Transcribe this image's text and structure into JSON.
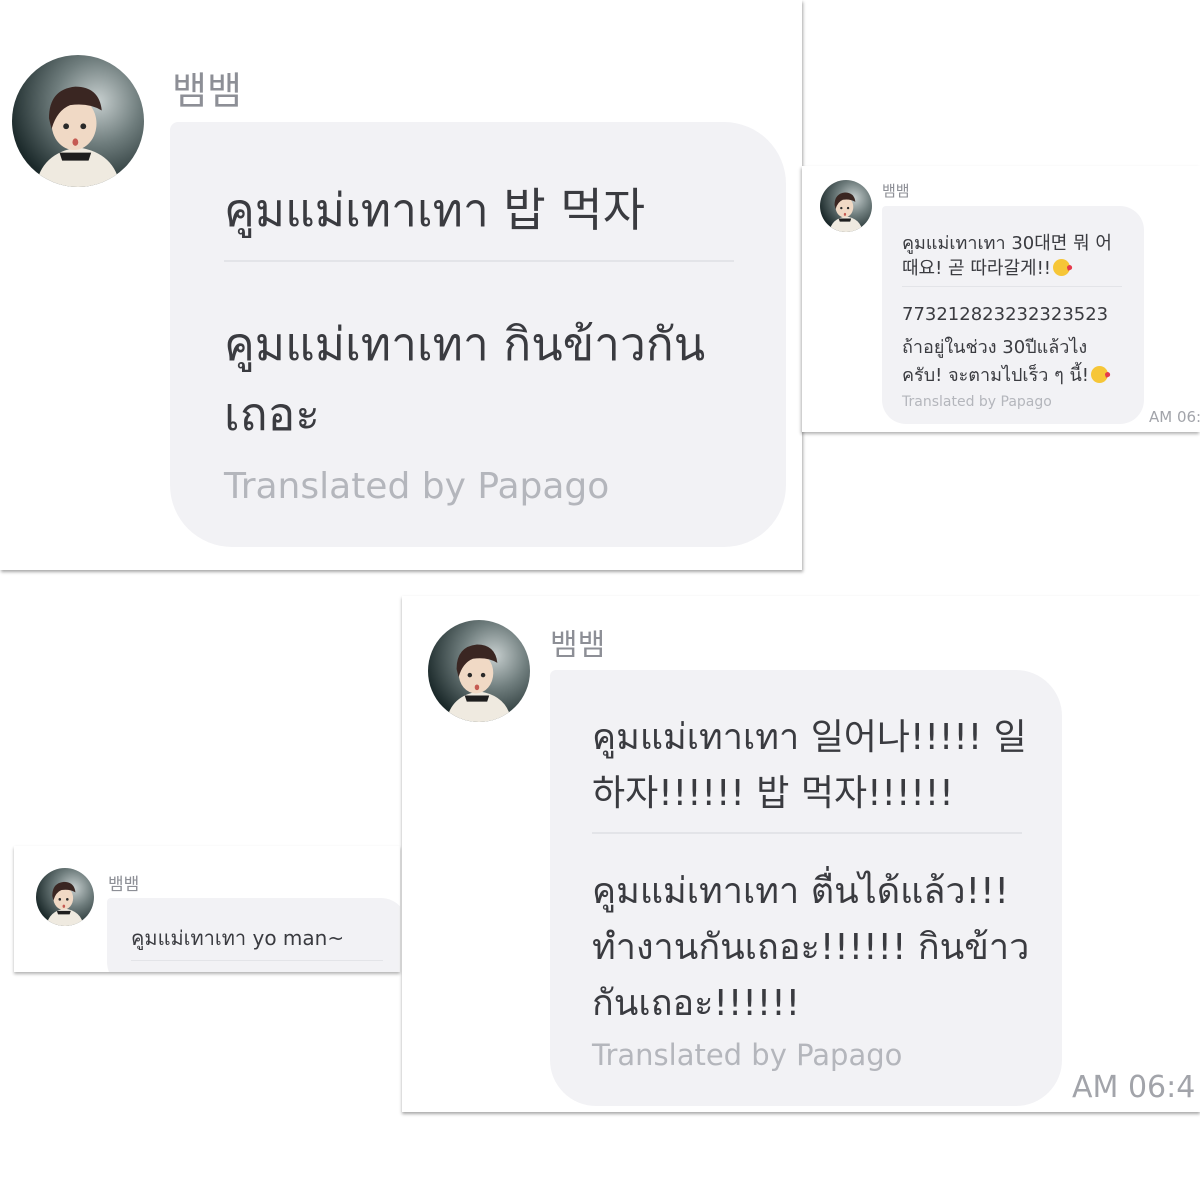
{
  "sender_name": "뱀뱀",
  "credit": "Translated by Papago",
  "colors": {
    "bubble": "#f2f2f5",
    "text": "#3a3b40",
    "muted": "#b4b6bc",
    "emoji": "#f6c637"
  },
  "msg1": {
    "original": "คูมแม่เทาเทา 밥 먹자",
    "translation_lines": [
      "คูมแม่เทาเทา กินข้าวกัน",
      "เถอะ"
    ]
  },
  "msg2": {
    "original_lines": [
      "คูมแม่เทาเทา 30대면 뭐 어",
      "때요! 곧 따라갈게!!"
    ],
    "translation_lines": [
      "773212823232323523",
      "ถ้าอยู่ในช่วง 30ปีแล้วไง",
      "ครับ! จะตามไปเร็ว ๆ นี้!"
    ],
    "emoji_icon": "kissing-face-emoji",
    "time": "AM 06:"
  },
  "msg3": {
    "original": "คูมแม่เทาเทา yo man~"
  },
  "msg4": {
    "original_lines": [
      "คูมแม่เทาเทา 일어나!!!!! 일",
      "하자!!!!!! 밥 먹자!!!!!!"
    ],
    "translation_lines": [
      "คูมแม่เทาเทา ตื่นได้แล้ว!!!",
      "ทำงานกันเถอะ!!!!!! กินข้าว",
      "กันเถอะ!!!!!!"
    ],
    "time": "AM 06:4"
  }
}
